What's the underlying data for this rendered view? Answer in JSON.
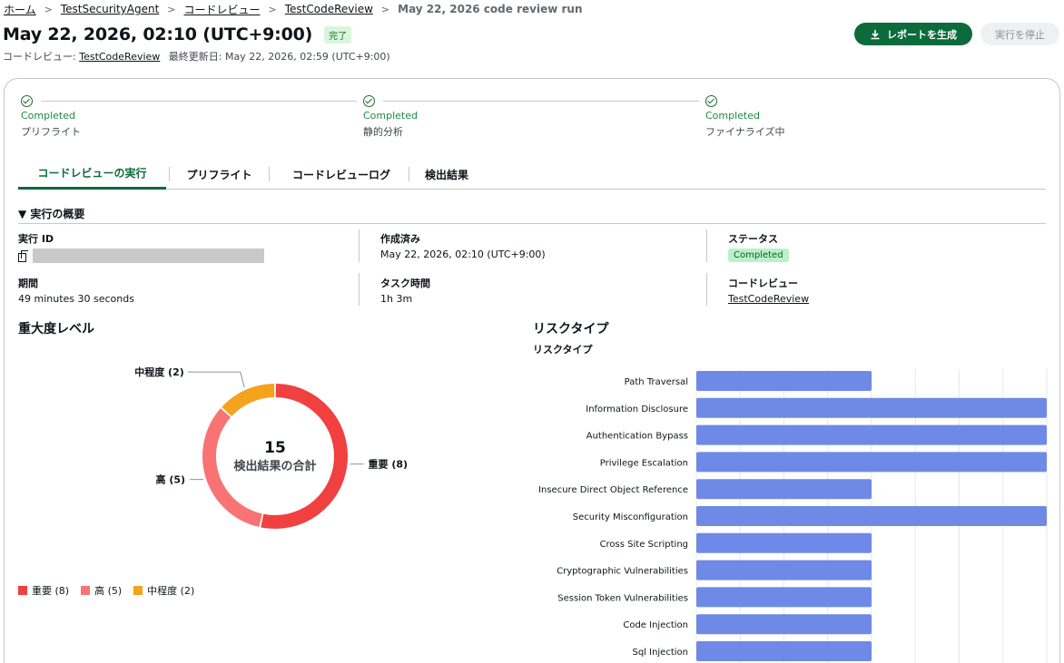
{
  "breadcrumb": {
    "home": "ホーム",
    "agent": "TestSecurityAgent",
    "review": "コードレビュー",
    "test": "TestCodeReview",
    "current": "May 22, 2026 code review run"
  },
  "header": {
    "title": "May 22, 2026, 02:10 (UTC+9:00)",
    "status_badge": "完了",
    "subtitle_label": "コードレビュー:",
    "subtitle_link": "TestCodeReview",
    "last_updated": "最終更新日: May 22, 2026, 02:59 (UTC+9:00)",
    "report_button": "レポートを生成",
    "stop_button": "実行を停止"
  },
  "steps": [
    {
      "status": "Completed",
      "name": "プリフライト"
    },
    {
      "status": "Completed",
      "name": "静的分析"
    },
    {
      "status": "Completed",
      "name": "ファイナライズ中"
    }
  ],
  "tabs": [
    "コードレビューの実行",
    "プリフライト",
    "コードレビューログ",
    "検出結果"
  ],
  "overview": {
    "heading": "▼ 実行の概要",
    "run_id_label": "実行 ID",
    "created_label": "作成済み",
    "created_value": "May 22, 2026, 02:10 (UTC+9:00)",
    "status_label": "ステータス",
    "status_value": "Completed",
    "duration_label": "期間",
    "duration_value": "49 minutes 30 seconds",
    "task_time_label": "タスク時間",
    "task_time_value": "1h 3m",
    "code_review_label": "コードレビュー",
    "code_review_value": "TestCodeReview"
  },
  "severity": {
    "heading": "重大度レベル",
    "total": "15",
    "total_label": "検出結果の合計",
    "legend": [
      "重要 (8)",
      "高 (5)",
      "中程度 (2)"
    ]
  },
  "risk": {
    "heading": "リスクタイプ",
    "subheading": "リスクタイプ"
  },
  "colors": {
    "critical": "#f04040",
    "high": "#f87474",
    "medium": "#f5a21d",
    "bar": "#6e8ae6",
    "accent": "#0b6b3a"
  },
  "chart_data": [
    {
      "type": "pie",
      "title": "重大度レベル",
      "categories": [
        "重要",
        "高",
        "中程度"
      ],
      "labels": [
        "重要 (8)",
        "高 (5)",
        "中程度 (2)"
      ],
      "values": [
        8,
        5,
        2
      ],
      "total": 15
    },
    {
      "type": "bar",
      "title": "リスクタイプ",
      "subtitle": "リスクタイプ",
      "orientation": "horizontal",
      "categories": [
        "Path Traversal",
        "Information Disclosure",
        "Authentication Bypass",
        "Privilege Escalation",
        "Insecure Direct Object Reference",
        "Security Misconfiguration",
        "Cross Site Scripting",
        "Cryptographic Vulnerabilities",
        "Session Token Vulnerabilities",
        "Code Injection",
        "Sql Injection"
      ],
      "values": [
        1,
        2,
        2,
        2,
        1,
        2,
        1,
        1,
        1,
        1,
        1
      ],
      "xlim": [
        0,
        2
      ],
      "grid": true
    }
  ]
}
